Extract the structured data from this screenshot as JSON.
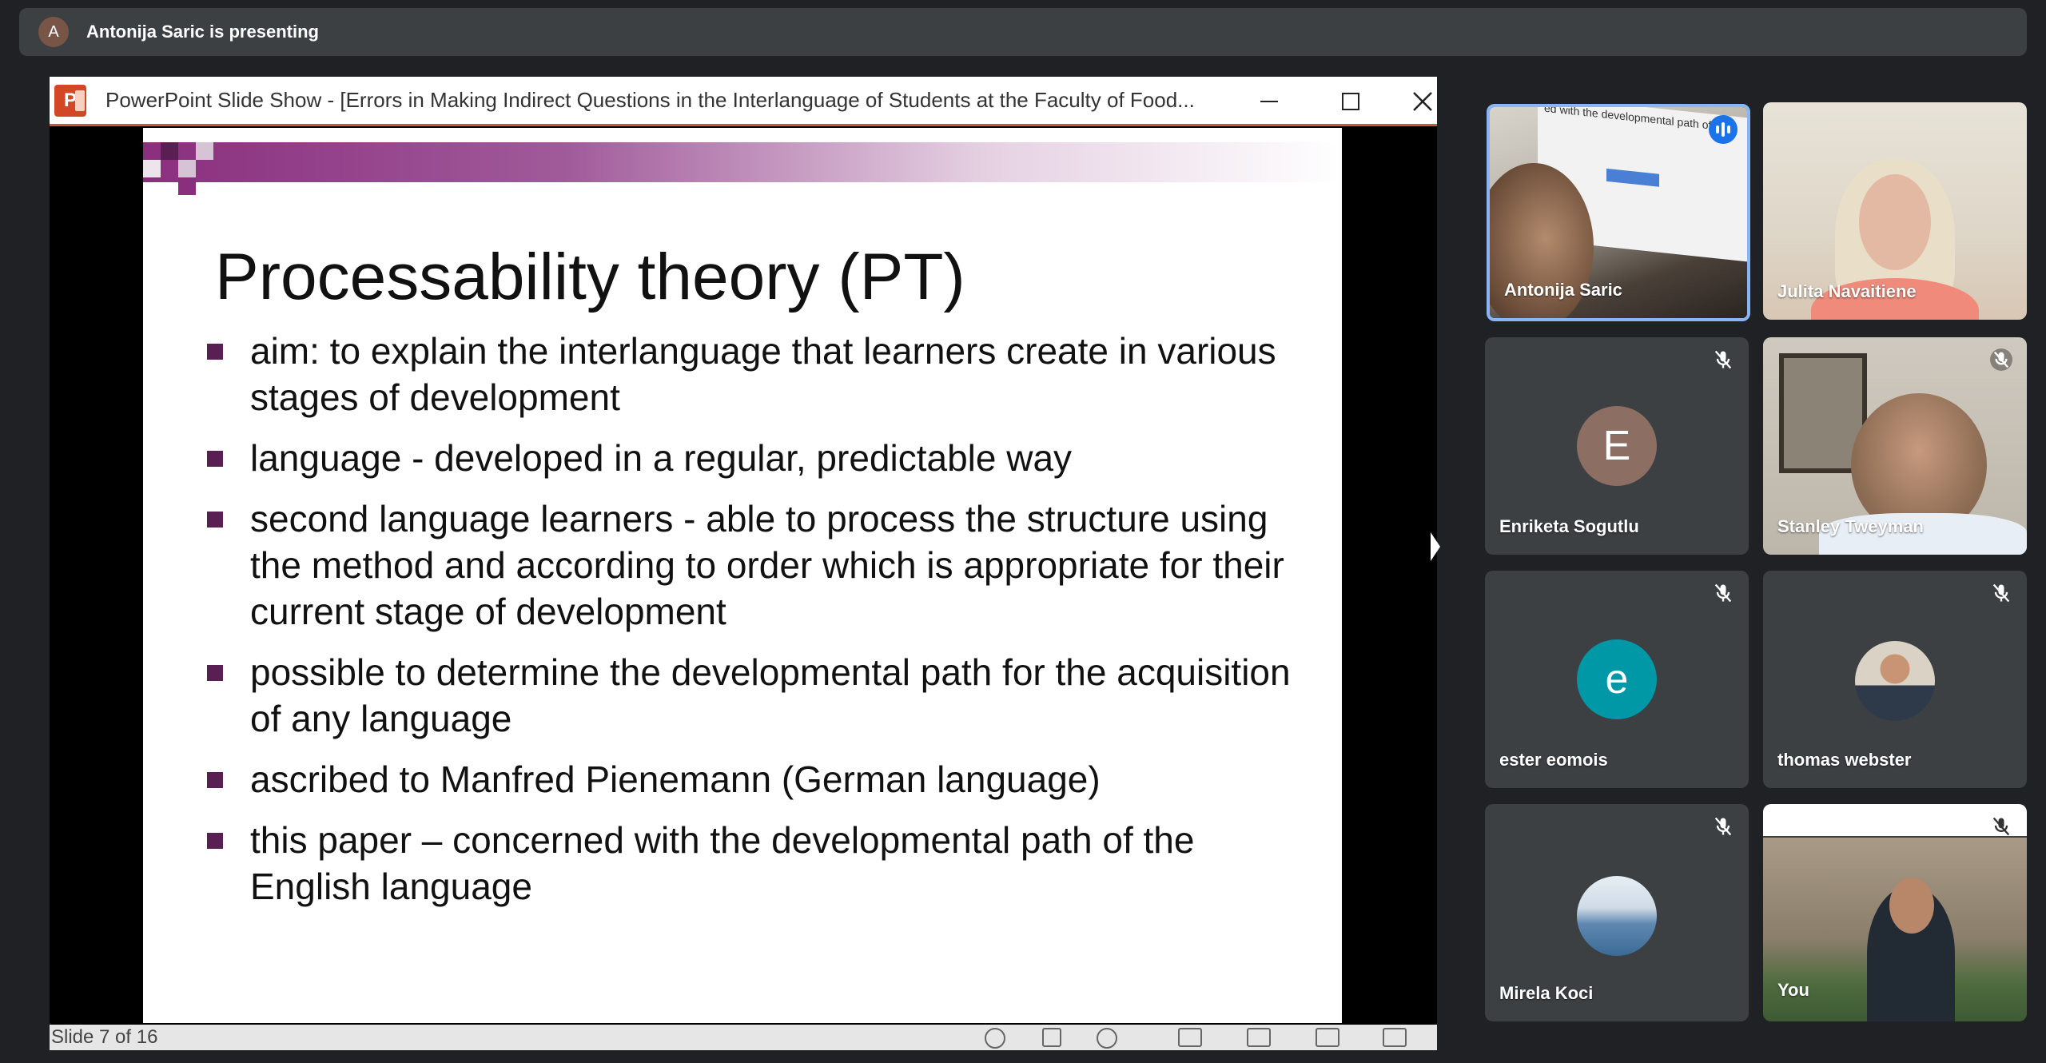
{
  "banner": {
    "avatar_letter": "A",
    "presenting_text": "Antonija Saric is presenting"
  },
  "shared_window": {
    "title": "PowerPoint Slide Show - [Errors in Making Indirect Questions in the Interlanguage of Students at the Faculty of Food...",
    "app_icon": "powerpoint-icon",
    "slide": {
      "title": "Processability theory (PT)",
      "bullets": [
        "aim: to explain the interlanguage that learners create in various stages of development",
        "language - developed in a regular, predictable way",
        "second language learners - able to process the structure using the method and according to order which is appropriate for their current stage of development",
        "possible to determine the developmental path for the acquisition of any language",
        "ascribed to Manfred Pienemann (German language)",
        "this paper – concerned with the developmental path of the English language"
      ]
    },
    "status": {
      "slide_counter": "Slide 7 of 16"
    },
    "mini_screen_text": "ed with the developmental path of"
  },
  "participants": [
    {
      "name": "Antonija Saric",
      "state": "speaking"
    },
    {
      "name": "Julita Navaitiene",
      "state": "video"
    },
    {
      "name": "Enriketa Sogutlu",
      "avatar_letter": "E",
      "avatar_color": "#8d6e63",
      "state": "muted"
    },
    {
      "name": "Stanley Tweyman",
      "state": "muted"
    },
    {
      "name": "ester eomois",
      "avatar_letter": "e",
      "avatar_color": "#0097a7",
      "state": "muted"
    },
    {
      "name": "thomas webster",
      "state": "muted"
    },
    {
      "name": "Mirela Koci",
      "state": "muted"
    },
    {
      "name": "You",
      "state": "muted"
    }
  ],
  "colors": {
    "background": "#202124",
    "tile": "#3c4043",
    "active_border": "#8ab4f8",
    "speaking_blue": "#1a73e8",
    "bullet": "#5a1f52"
  }
}
